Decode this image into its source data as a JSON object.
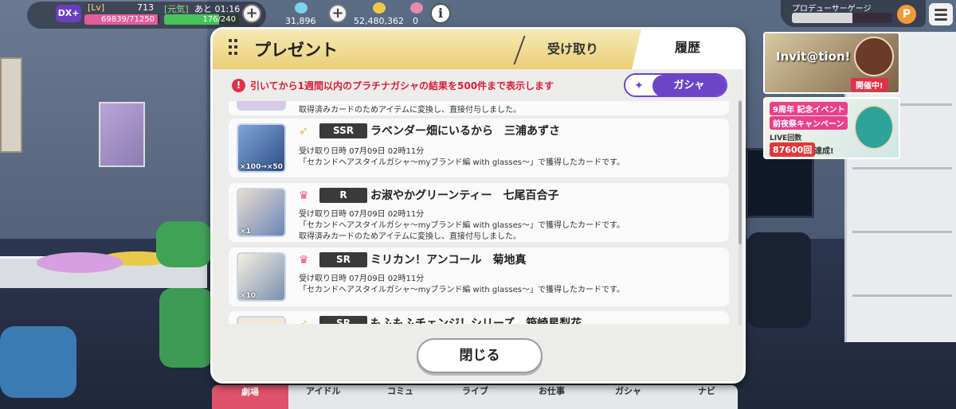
{
  "hud": {
    "badge": "DX+",
    "lv_label": "[Lv]",
    "lv_value": "713",
    "exp_text": "69839/71250",
    "exp_fraction": 0.98,
    "genki_label": "[元気]",
    "genki_time": "あと 01:16",
    "genki_text": "176/240",
    "genki_fraction": 0.73,
    "currency1": "31,896",
    "currency2": "52,480,362",
    "currency3": "0",
    "info_icon": "i",
    "producer_label": "プロデューサーゲージ",
    "producer_text": "60/100",
    "producer_fraction": 0.6,
    "producer_icon": "P"
  },
  "banners": {
    "b1_title": "Invit@tion!",
    "b1_tag": "開催中!",
    "b2_line1": "9周年 記念イベント",
    "b2_line2": "前夜祭キャンペーン",
    "b2_line3": "LIVE回数",
    "b2_count": "87600回",
    "b2_done": "達成!"
  },
  "dialog": {
    "title": "プレゼント",
    "tab_receive": "受け取り",
    "tab_history": "履歴",
    "notice": "引いてから1週間以内のプラチナガシャの結果を500件まで表示します",
    "gacha_button": "ガシャ",
    "close_button": "閉じる",
    "partial_top": "取得済みカードのためアイテムに変換し、直接付与しました。",
    "rows": [
      {
        "rarity": "SSR",
        "card": "ラベンダー畑にいるから　三浦あずさ",
        "count": "×100→×50",
        "date": "受け取り日時 07月09日 02時11分",
        "line1": "「セカンドヘアスタイルガシャ～myブランド編 with glasses～」で獲得したカードです。",
        "line2": ""
      },
      {
        "rarity": "R",
        "card": "お淑やかグリーンティー　七尾百合子",
        "count": "×1",
        "date": "受け取り日時 07月09日 02時11分",
        "line1": "「セカンドヘアスタイルガシャ～myブランド編 with glasses～」で獲得したカードです。",
        "line2": "取得済みカードのためアイテムに変換し、直接付与しました。"
      },
      {
        "rarity": "SR",
        "card": "ミリカン！アンコール　菊地真",
        "count": "×10",
        "date": "受け取り日時 07月09日 02時11分",
        "line1": "「セカンドヘアスタイルガシャ～myブランド編 with glasses～」で獲得したカードです。",
        "line2": ""
      },
      {
        "rarity": "SR",
        "card": "もふもふチェンジ！シリーズ　箱崎星梨花",
        "count": "",
        "date": "",
        "line1": "",
        "line2": ""
      }
    ]
  },
  "nav": [
    "劇場",
    "アイドル",
    "コミュ",
    "ライブ",
    "お仕事",
    "ガシャ",
    "ナビ"
  ],
  "colors": {
    "accent": "#6b44c8",
    "notice": "#d81e3c",
    "header_gold": "#e9cf77"
  }
}
